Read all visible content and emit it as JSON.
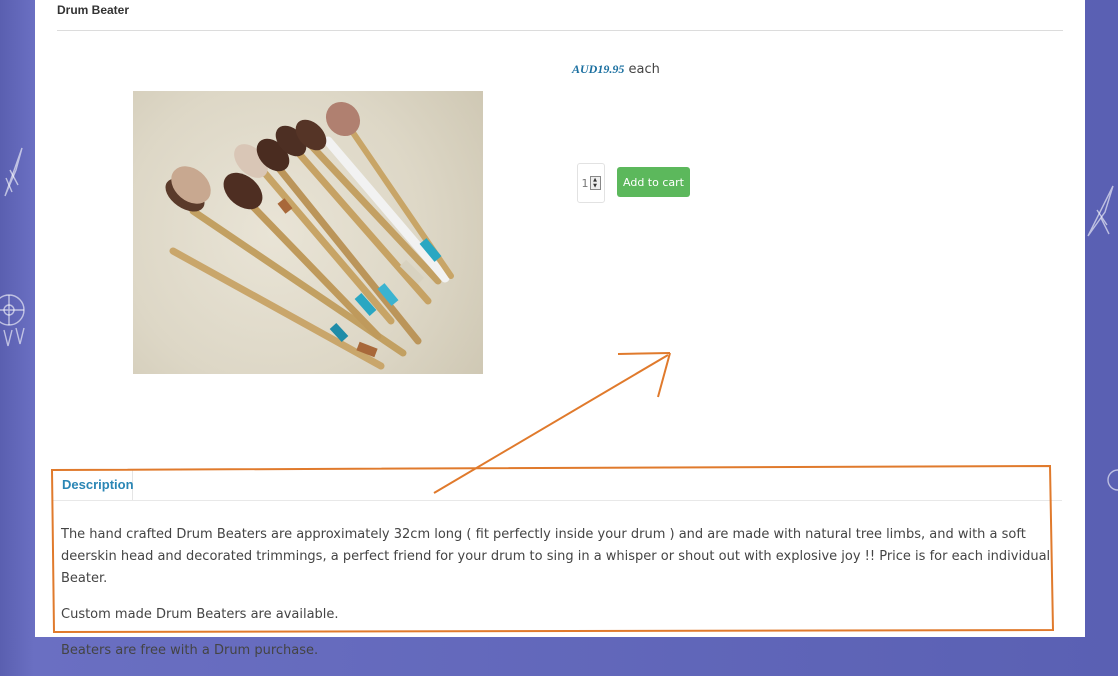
{
  "product": {
    "title": "Drum Beater",
    "price_amount": "AUD19.95",
    "price_unit": "each",
    "quantity": "1",
    "add_to_cart_label": "Add to cart"
  },
  "description": {
    "tab_label": "Description",
    "paragraphs": [
      "The hand crafted Drum Beaters are approximately 32cm long ( fit perfectly inside your drum ) and are made with natural tree limbs, and with a soft deerskin head and decorated trimmings, a perfect friend for your drum to sing in a whisper or shout out with explosive joy !! Price is for each individual Beater.",
      "Custom made Drum Beaters are available.",
      "Beaters are free with a Drum purchase."
    ]
  },
  "icons": [
    "feather-icon",
    "dreamcatcher-icon",
    "spinner-arrows-icon"
  ],
  "colors": {
    "background": "#5a60b3",
    "price": "#1a6fa0",
    "tab_text": "#2a86b5",
    "button": "#5cb85c",
    "annotation": "#e07a2c"
  }
}
